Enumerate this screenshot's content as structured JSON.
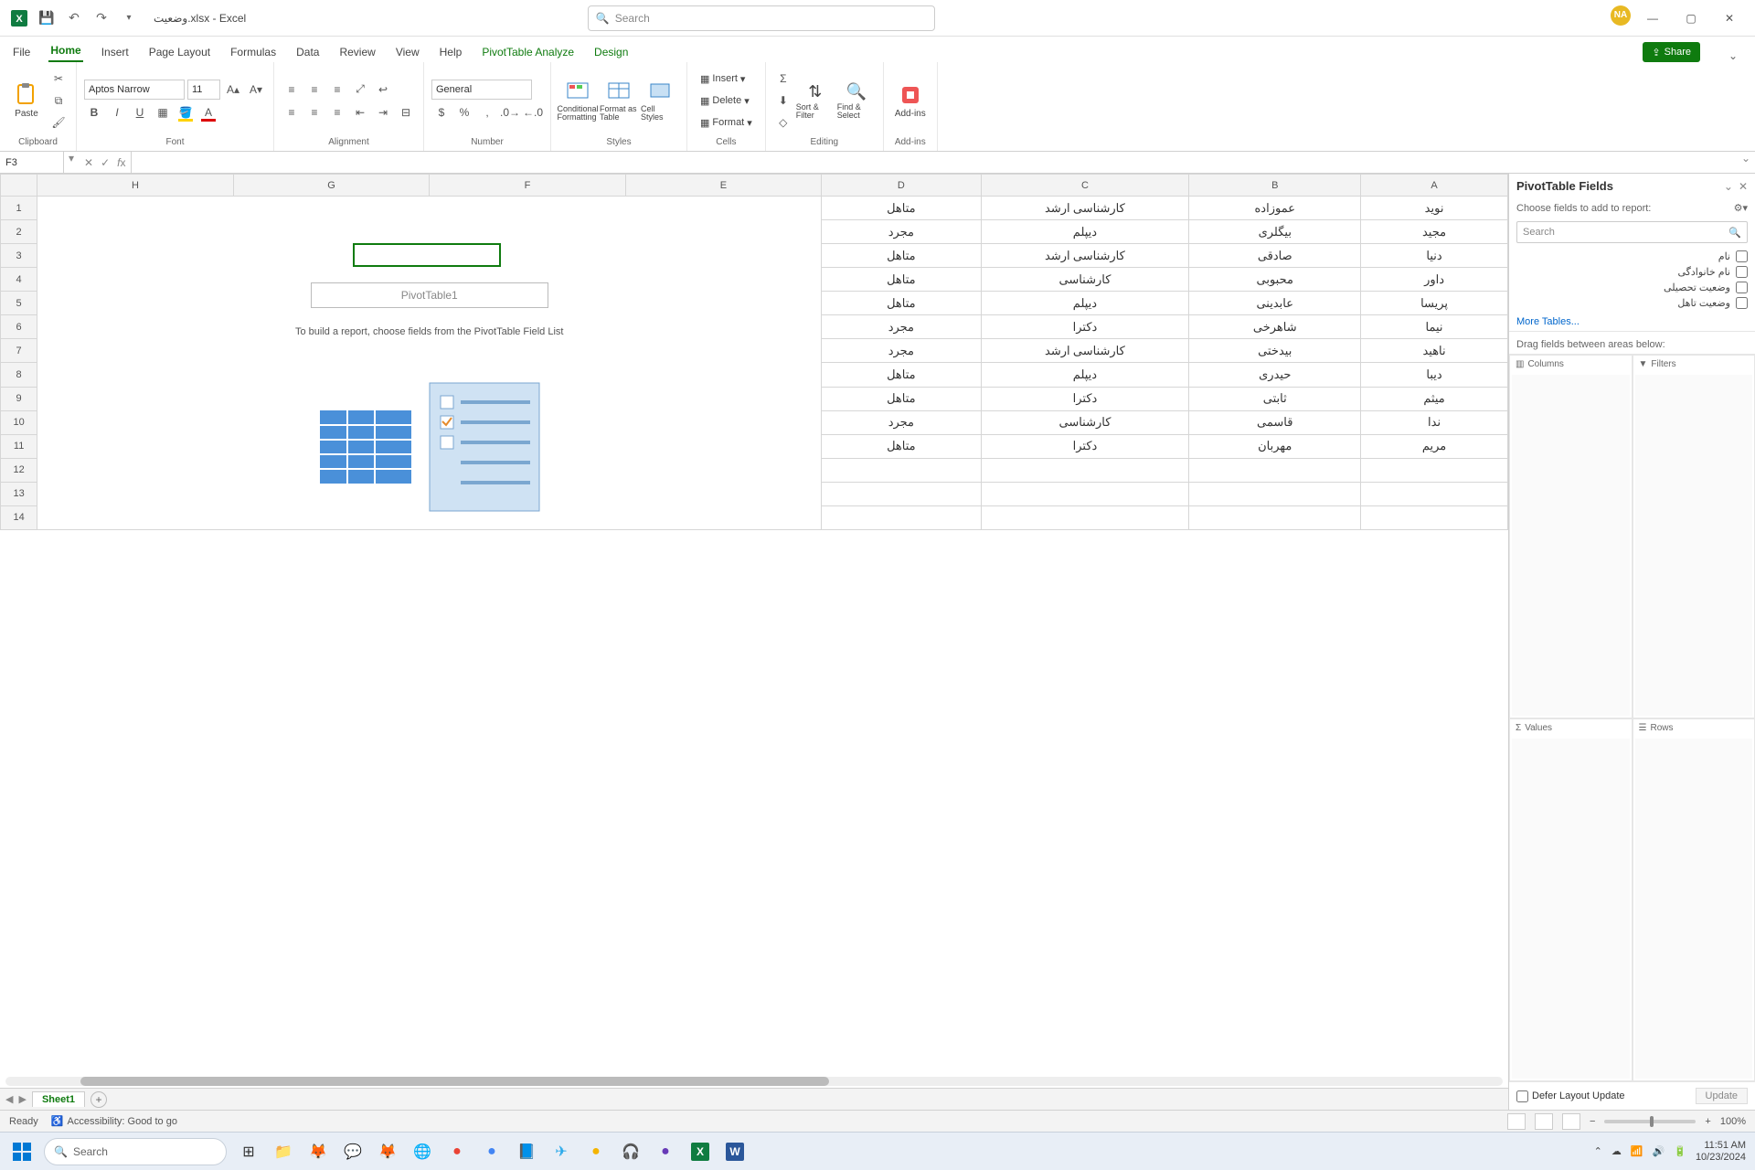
{
  "window": {
    "app_title": "وضعیت.xlsx - Excel",
    "search_placeholder": "Search",
    "avatar": "NA"
  },
  "tabs": {
    "items": [
      "File",
      "Home",
      "Insert",
      "Page Layout",
      "Formulas",
      "Data",
      "Review",
      "View",
      "Help",
      "PivotTable Analyze",
      "Design"
    ],
    "active": "Home",
    "share": "Share"
  },
  "ribbon": {
    "clipboard": {
      "paste": "Paste",
      "label": "Clipboard"
    },
    "font": {
      "name": "Aptos Narrow",
      "size": "11",
      "label": "Font"
    },
    "alignment": {
      "label": "Alignment"
    },
    "number": {
      "format": "General",
      "label": "Number"
    },
    "styles": {
      "cond": "Conditional Formatting",
      "table": "Format as Table",
      "cell": "Cell Styles",
      "label": "Styles"
    },
    "cells": {
      "insert": "Insert",
      "delete": "Delete",
      "format": "Format",
      "label": "Cells"
    },
    "editing": {
      "sort": "Sort & Filter",
      "find": "Find & Select",
      "label": "Editing"
    },
    "addins": {
      "btn": "Add-ins",
      "label": "Add-ins"
    }
  },
  "formula_bar": {
    "cell_ref": "F3",
    "formula": ""
  },
  "columns": [
    "H",
    "G",
    "F",
    "E",
    "D",
    "C",
    "B",
    "A"
  ],
  "rows": [
    1,
    2,
    3,
    4,
    5,
    6,
    7,
    8,
    9,
    10,
    11,
    12,
    13,
    14
  ],
  "pivot": {
    "title": "PivotTable1",
    "message": "To build a report, choose fields from the PivotTable Field List"
  },
  "data_rows": [
    {
      "A": "نوید",
      "B": "عموزاده",
      "C": "کارشناسی ارشد",
      "D": "متاهل"
    },
    {
      "A": "مجید",
      "B": "بیگلری",
      "C": "دیپلم",
      "D": "مجرد"
    },
    {
      "A": "دنیا",
      "B": "صادقی",
      "C": "کارشناسی ارشد",
      "D": "متاهل"
    },
    {
      "A": "داور",
      "B": "محبوبی",
      "C": "کارشناسی",
      "D": "متاهل"
    },
    {
      "A": "پریسا",
      "B": "عابدینی",
      "C": "دیپلم",
      "D": "متاهل"
    },
    {
      "A": "نیما",
      "B": "شاهرخی",
      "C": "دکترا",
      "D": "مجرد"
    },
    {
      "A": "ناهید",
      "B": "بیدختی",
      "C": "کارشناسی ارشد",
      "D": "مجرد"
    },
    {
      "A": "دیبا",
      "B": "حیدری",
      "C": "دیپلم",
      "D": "متاهل"
    },
    {
      "A": "میثم",
      "B": "ثابتی",
      "C": "دکترا",
      "D": "متاهل"
    },
    {
      "A": "ندا",
      "B": "قاسمی",
      "C": "کارشناسی",
      "D": "مجرد"
    },
    {
      "A": "مریم",
      "B": "مهربان",
      "C": "دکترا",
      "D": "متاهل"
    }
  ],
  "sheet_tabs": {
    "active": "Sheet1"
  },
  "pane": {
    "title": "PivotTable Fields",
    "subtitle": "Choose fields to add to report:",
    "search_placeholder": "Search",
    "fields": [
      "نام",
      "نام خانوادگی",
      "وضعیت تحصیلی",
      "وضعیت تاهل"
    ],
    "more": "More Tables...",
    "drag_label": "Drag fields between areas below:",
    "zones": {
      "columns": "Columns",
      "filters": "Filters",
      "values": "Values",
      "rows": "Rows"
    },
    "defer": "Defer Layout Update",
    "update": "Update"
  },
  "status": {
    "ready": "Ready",
    "accessibility": "Accessibility: Good to go",
    "zoom": "100%"
  },
  "taskbar": {
    "search": "Search",
    "time": "11:51 AM",
    "date": "10/23/2024"
  }
}
